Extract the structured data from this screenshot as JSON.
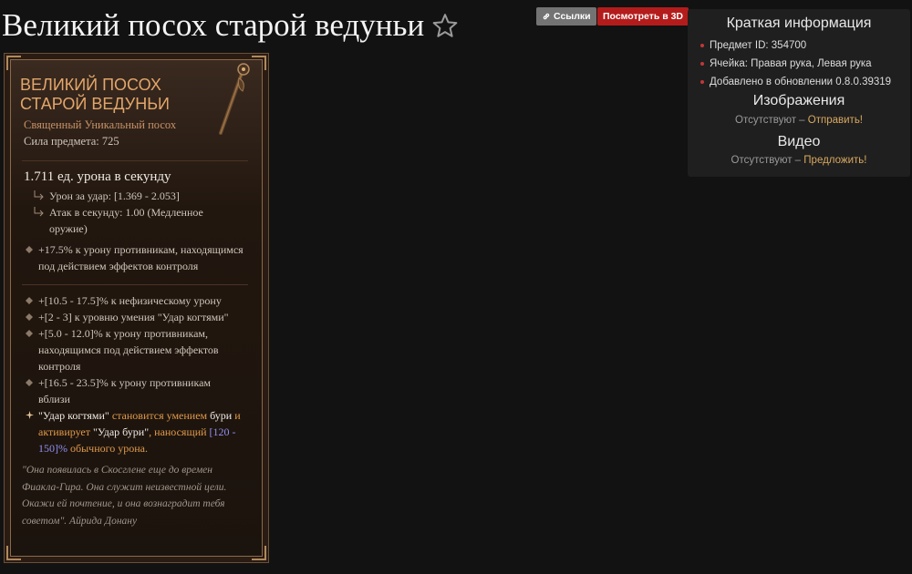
{
  "page": {
    "title": "Великий посох старой ведуньи"
  },
  "buttons": {
    "links_label": "Ссылки",
    "view3d_label": "Посмотреть в 3D"
  },
  "info_panel": {
    "title": "Краткая информация",
    "items": [
      "Предмет ID: 354700",
      "Ячейка: Правая рука, Левая рука",
      "Добавлено в обновлении 0.8.0.39319"
    ],
    "images_title": "Изображения",
    "images_status": "Отсутствуют",
    "images_sep": " – ",
    "images_action": "Отправить!",
    "video_title": "Видео",
    "video_status": "Отсутствуют",
    "video_sep": " – ",
    "video_action": "Предложить!"
  },
  "item": {
    "name_line1": "ВЕЛИКИЙ ПОСОХ",
    "name_line2": "СТАРОЙ ВЕДУНЬИ",
    "type": "Священный Уникальный посох",
    "power": "Сила предмета: 725",
    "dps": "1.711 ед. урона в секунду",
    "damage_per_hit": "Урон за удар: [1.369 - 2.053]",
    "attacks_per_second_1": "Атак в секунду: 1.00 (Медленное",
    "attacks_per_second_2": "оружие)",
    "implicit_1": "+17.5% к урону противникам, находящимся",
    "implicit_2": "под действием эффектов контроля",
    "affixes": [
      [
        "+[10.5 - 17.5]% к нефизическому урону"
      ],
      [
        "+[2 - 3] к уровню умения \"Удар когтями\""
      ],
      [
        "+[5.0 - 12.0]% к урону противникам,",
        "находящимся под действием эффектов",
        "контроля"
      ],
      [
        "+[16.5 - 23.5]% к урону противникам",
        "вблизи"
      ]
    ],
    "unique_power": {
      "p1": "\"Удар когтями\"",
      "p2": " становится умением ",
      "p3": "бури",
      "p4": " и",
      "p5": "активирует ",
      "p6": "\"Удар бури\"",
      "p7": ", наносящий ",
      "p8": "[120 -",
      "p9": "150]%",
      "p10": " обычного урона."
    },
    "flavor": [
      "\"Она появилась в Скосглене еще до времен",
      "Фиакла-Гира. Она служит неизвестной цели.",
      "Окажи ей почтение, и она вознаградит тебя",
      "советом\". Айрида Донану"
    ]
  }
}
